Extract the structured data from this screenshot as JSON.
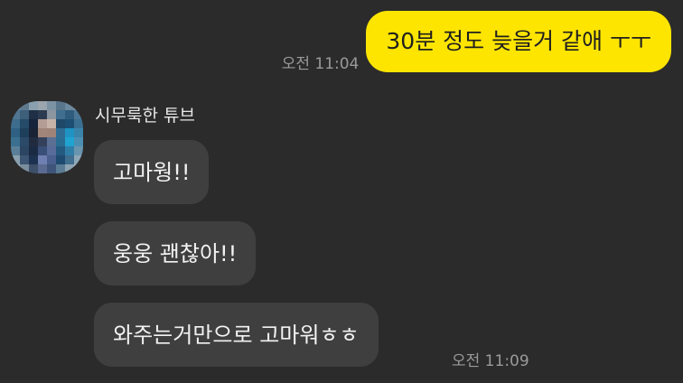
{
  "chat": {
    "outgoing": [
      {
        "text": "30분 정도 늦을거 같애 ㅜㅜ",
        "time": "오전 11:04"
      }
    ],
    "incoming": {
      "sender": "시무룩한 튜브",
      "avatar": "blurred-profile-photo",
      "messages": [
        {
          "text": "고마웡!!"
        },
        {
          "text": "웅웅 괜찮아!!"
        },
        {
          "text": "와주는거만으로 고마워ㅎㅎ"
        }
      ],
      "time": "오전 11:09"
    }
  },
  "colors": {
    "background": "#2b2b2b",
    "outgoing_bubble": "#fee500",
    "incoming_bubble": "#3f3f3f",
    "timestamp": "#9a9a9a"
  }
}
